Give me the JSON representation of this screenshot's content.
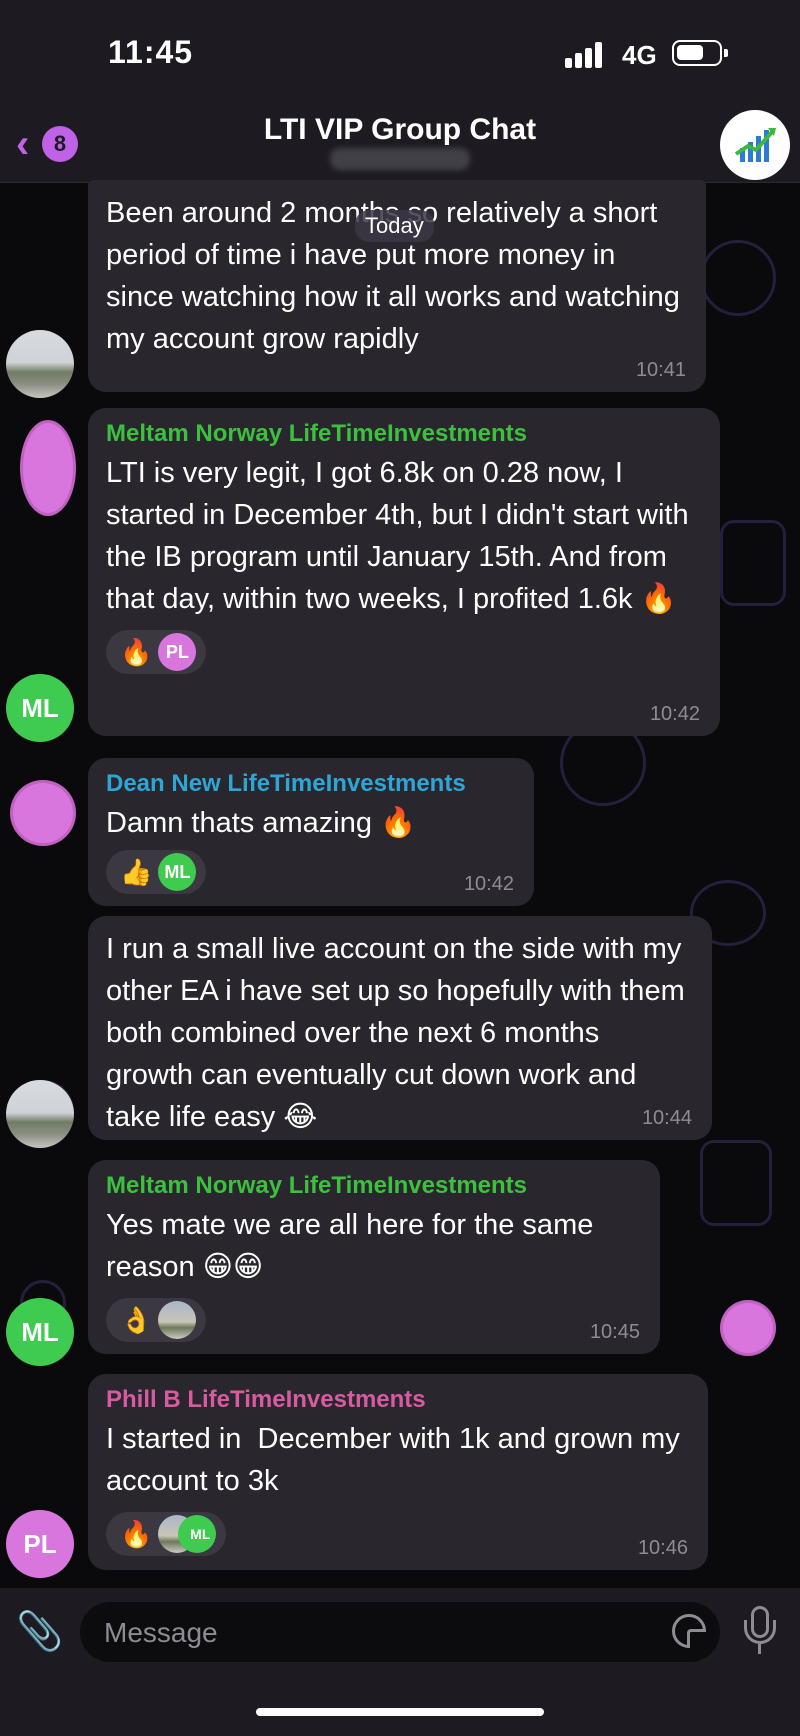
{
  "status": {
    "time": "11:45",
    "network": "4G"
  },
  "header": {
    "back_badge": "8",
    "title": "LTI VIP Group Chat"
  },
  "date_pill": "Today",
  "messages": [
    {
      "sender": "",
      "text": "Been around 2 months so relatively a short period of time i have put more money in since watching how it all works and watching my account grow rapidly",
      "time": "10:41"
    },
    {
      "sender": "Meltam Norway LifeTimeInvestments",
      "sender_color": "#3cc13e",
      "text": "LTI is very legit, I got 6.8k on 0.28 now, I started in December 4th, but I didn't start with the IB program until January 15th. And from that day, within two weeks, I profited 1.6k 🔥",
      "time": "10:42",
      "reaction_emoji": "🔥",
      "reactors": [
        "PL"
      ]
    },
    {
      "sender": "Dean New LifeTimeInvestments",
      "sender_color": "#2da6d6",
      "text": "Damn thats amazing 🔥",
      "time": "10:42",
      "reaction_emoji": "👍",
      "reactors": [
        "ML"
      ]
    },
    {
      "sender": "",
      "text": "I run a small live account on the side with my other EA i have set up so hopefully with them both combined over the next 6 months growth can eventually cut down work and take life easy 😂",
      "time": "10:44"
    },
    {
      "sender": "Meltam Norway LifeTimeInvestments",
      "sender_color": "#3cc13e",
      "text": "Yes mate we are all here for the same reason 😁😁",
      "time": "10:45",
      "reaction_emoji": "👌"
    },
    {
      "sender": "Phill B LifeTimeInvestments",
      "sender_color": "#d85aa0",
      "text": "I started in  December with 1k and grown my account to 3k",
      "time": "10:46",
      "reaction_emoji": "🔥",
      "reactors": [
        "ML"
      ]
    }
  ],
  "avatars": {
    "ml": "ML",
    "pl": "PL"
  },
  "input": {
    "placeholder": "Message"
  }
}
